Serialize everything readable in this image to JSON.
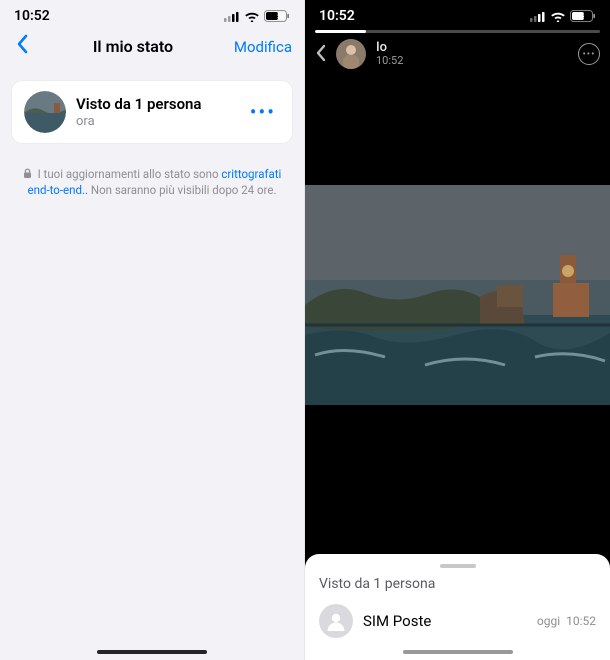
{
  "statusbar": {
    "time": "10:52",
    "battery": "58"
  },
  "left": {
    "title": "Il mio stato",
    "edit_label": "Modifica",
    "card": {
      "title": "Visto da 1 persona",
      "subtitle": "ora",
      "more_label": "•••"
    },
    "note": {
      "prefix": "I tuoi aggiornamenti allo stato sono ",
      "link": "crittografati end-to-end..",
      "suffix": " Non saranno più visibili dopo 24 ore."
    }
  },
  "right": {
    "progress_pct": "18",
    "author": "Io",
    "time": "10:52",
    "sheet_title": "Visto da 1 persona",
    "viewer": {
      "name": "SIM Poste",
      "day": "oggi",
      "time": "10:52"
    }
  }
}
